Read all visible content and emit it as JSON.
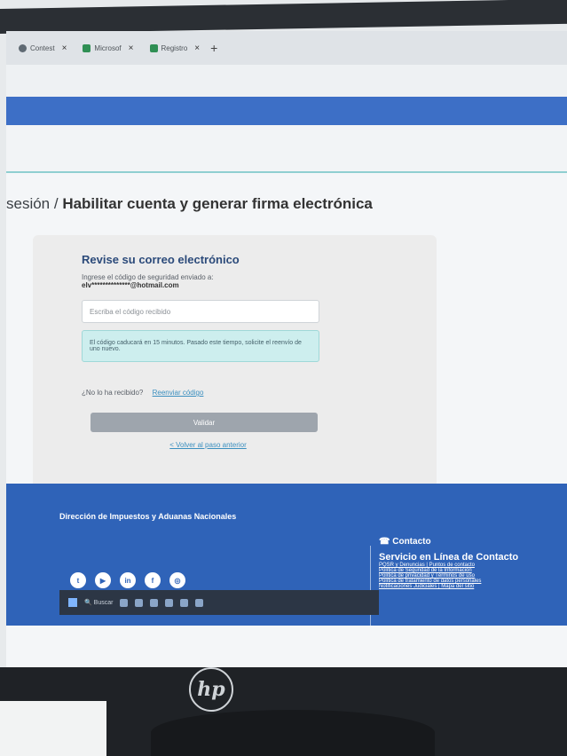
{
  "browser": {
    "tabs": [
      {
        "label": "Contest",
        "icon": "globe-icon"
      },
      {
        "label": "Microsof",
        "icon": "microsoft-icon"
      },
      {
        "label": "Registro",
        "icon": "microsoft-icon"
      }
    ],
    "new_tab": "+"
  },
  "page": {
    "title_prefix": "sesión / ",
    "title_main": "Habilitar cuenta y generar firma electrónica"
  },
  "form": {
    "heading": "Revise su correo electrónico",
    "instruction": "Ingrese el código de seguridad enviado a:",
    "email": "elv**************@hotmail.com",
    "code_placeholder": "Escriba el código recibido",
    "notice": "El código caducará en 15 minutos. Pasado este tiempo, solicite el reenvío de uno nuevo.",
    "resend_question": "¿No lo ha recibido?",
    "resend_link": "Reenviar código",
    "submit": "Validar",
    "back": "< Volver al paso anterior"
  },
  "footer": {
    "org": "Dirección de Impuestos y Aduanas Nacionales",
    "contact_title": "Contacto",
    "service_title": "Servicio en Línea de Contacto",
    "links": [
      "PQSR y Denuncias | Puntos de contacto",
      "Política de Seguridad de la Información",
      "Política de privacidad y Términos de uso",
      "Política de tratamiento de datos personales",
      "Notificaciones Judiciales | Mapa del sitio"
    ]
  },
  "taskbar": {
    "search": "Buscar"
  },
  "brand": {
    "monitor": "hp"
  },
  "colors": {
    "accent": "#2f63b8",
    "notice": "#cdeeee",
    "button": "#9ea5ad"
  }
}
